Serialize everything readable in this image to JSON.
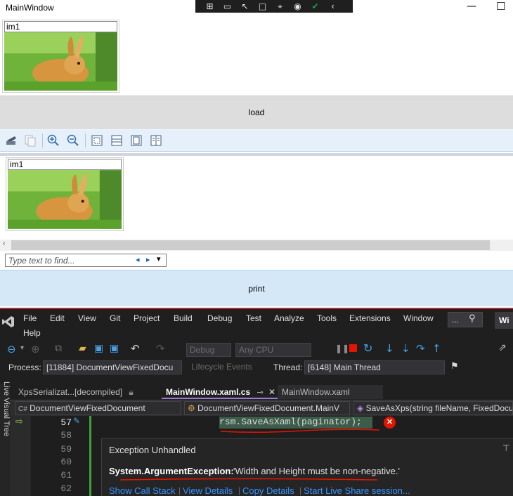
{
  "window": {
    "title": "MainWindow",
    "minimize": "—",
    "maximize": "☐"
  },
  "debug_toolbar": {
    "icons": [
      "live-tree-icon",
      "record-icon",
      "select-element-icon",
      "display-adorners-icon",
      "track-focus-icon",
      "hot-reload-icon",
      "checkmark-icon",
      "collapse-icon"
    ]
  },
  "image1": {
    "caption": "im1"
  },
  "load_button": {
    "label": "load"
  },
  "viewer": {
    "image_caption": "im1",
    "find": {
      "placeholder": "Type text to find...",
      "prev": "◂",
      "next": "▸",
      "menu": "▾"
    }
  },
  "print_button": {
    "label": "print"
  },
  "vs": {
    "menu": [
      "File",
      "Edit",
      "View",
      "Git",
      "Project",
      "Build",
      "Debug",
      "Test",
      "Analyze",
      "Tools",
      "Extensions",
      "Window",
      "Help"
    ],
    "search_text": "...",
    "window_label": "Wi",
    "toolbar": {
      "config": "Debug",
      "platform": "Any CPU"
    },
    "process_label": "Process:",
    "process_value": "[11884] DocumentViewFixedDocu",
    "lifecycle": "Lifecycle Events",
    "thread_label": "Thread:",
    "thread_value": "[6148] Main Thread",
    "side_label": "Live Visual Tree",
    "tabs": [
      {
        "label": "XpsSerializat...[decompiled]"
      },
      {
        "label": "MainWindow.xaml.cs"
      },
      {
        "label": "MainWindow.xaml"
      }
    ],
    "nav": {
      "project": "DocumentViewFixedDocument",
      "class": "DocumentViewFixedDocument.MainV",
      "member": "SaveAsXps(string fileName, FixedDocu"
    },
    "lines": [
      "57",
      "58",
      "59",
      "60",
      "61",
      "62"
    ],
    "code_line": "rsm.SaveAsXaml(paginator);",
    "exception": {
      "title": "Exception Unhandled",
      "type": "System.ArgumentException:",
      "message": "'Width and Height must be non-negative.'",
      "links": [
        "Show Call Stack",
        "View Details",
        "Copy Details",
        "Start Live Share session..."
      ]
    },
    "colors": {
      "accent": "#9c7bd6",
      "error": "#e51400",
      "link": "#3794ff",
      "bg": "#1f1f1f"
    }
  }
}
